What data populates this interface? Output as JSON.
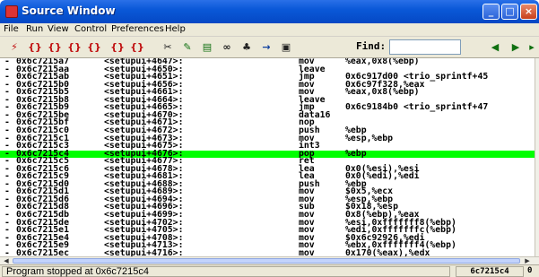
{
  "window": {
    "title": "Source Window",
    "min_icon": "minimize-icon",
    "max_icon": "maximize-icon",
    "close_icon": "close-icon"
  },
  "menu": {
    "items": [
      "File",
      "Run",
      "View",
      "Control",
      "Preferences",
      "Help"
    ]
  },
  "toolbar": {
    "find_label": "Find:",
    "find_value": "",
    "icons": [
      "run-icon",
      "step-icon",
      "next-icon",
      "finish-icon",
      "continue-icon",
      "stepi-icon",
      "nexti-icon",
      "up-stack-icon",
      "down-stack-icon",
      "bottom-stack-icon",
      "watch-icon",
      "locals-icon",
      "breakpoints-icon",
      "registers-icon",
      "memory-icon",
      "find-prev-icon",
      "find-next-icon"
    ]
  },
  "code": {
    "highlight_color": "#00ff00",
    "rows": [
      {
        "marker": "-",
        "addr": "0x6c7215a7",
        "sym": "<setupui+4647>:",
        "mn": "mov",
        "op": "%eax,0x8(%ebp)"
      },
      {
        "marker": "-",
        "addr": "0x6c7215aa",
        "sym": "<setupui+4650>:",
        "mn": "leave",
        "op": ""
      },
      {
        "marker": "-",
        "addr": "0x6c7215ab",
        "sym": "<setupui+4651>:",
        "mn": "jmp",
        "op": "0x6c917d00 <trio_sprintf+45"
      },
      {
        "marker": "-",
        "addr": "0x6c7215b0",
        "sym": "<setupui+4656>:",
        "mn": "mov",
        "op": "0x6c97f328,%eax"
      },
      {
        "marker": "-",
        "addr": "0x6c7215b5",
        "sym": "<setupui+4661>:",
        "mn": "mov",
        "op": "%eax,0x8(%ebp)"
      },
      {
        "marker": "-",
        "addr": "0x6c7215b8",
        "sym": "<setupui+4664>:",
        "mn": "leave",
        "op": ""
      },
      {
        "marker": "-",
        "addr": "0x6c7215b9",
        "sym": "<setupui+4665>:",
        "mn": "jmp",
        "op": "0x6c9184b0 <trio_sprintf+47"
      },
      {
        "marker": "-",
        "addr": "0x6c7215be",
        "sym": "<setupui+4670>:",
        "mn": "data16",
        "op": ""
      },
      {
        "marker": "-",
        "addr": "0x6c7215bf",
        "sym": "<setupui+4671>:",
        "mn": "nop",
        "op": ""
      },
      {
        "marker": "-",
        "addr": "0x6c7215c0",
        "sym": "<setupui+4672>:",
        "mn": "push",
        "op": "%ebp"
      },
      {
        "marker": "-",
        "addr": "0x6c7215c1",
        "sym": "<setupui+4673>:",
        "mn": "mov",
        "op": "%esp,%ebp"
      },
      {
        "marker": "-",
        "addr": "0x6c7215c3",
        "sym": "<setupui+4675>:",
        "mn": "int3",
        "op": ""
      },
      {
        "marker": "-",
        "addr": "0x6c7215c4",
        "sym": "<setupui+4676>:",
        "mn": "pop",
        "op": "%ebp",
        "highlight": true
      },
      {
        "marker": "-",
        "addr": "0x6c7215c5",
        "sym": "<setupui+4677>:",
        "mn": "ret",
        "op": ""
      },
      {
        "marker": "-",
        "addr": "0x6c7215c6",
        "sym": "<setupui+4678>:",
        "mn": "lea",
        "op": "0x0(%esi),%esi"
      },
      {
        "marker": "-",
        "addr": "0x6c7215c9",
        "sym": "<setupui+4681>:",
        "mn": "lea",
        "op": "0x0(%edi),%edi"
      },
      {
        "marker": "-",
        "addr": "0x6c7215d0",
        "sym": "<setupui+4688>:",
        "mn": "push",
        "op": "%ebp"
      },
      {
        "marker": "-",
        "addr": "0x6c7215d1",
        "sym": "<setupui+4689>:",
        "mn": "mov",
        "op": "$0x5,%ecx"
      },
      {
        "marker": "-",
        "addr": "0x6c7215d6",
        "sym": "<setupui+4694>:",
        "mn": "mov",
        "op": "%esp,%ebp"
      },
      {
        "marker": "-",
        "addr": "0x6c7215d8",
        "sym": "<setupui+4696>:",
        "mn": "sub",
        "op": "$0x18,%esp"
      },
      {
        "marker": "-",
        "addr": "0x6c7215db",
        "sym": "<setupui+4699>:",
        "mn": "mov",
        "op": "0x8(%ebp),%eax"
      },
      {
        "marker": "-",
        "addr": "0x6c7215de",
        "sym": "<setupui+4702>:",
        "mn": "mov",
        "op": "%esi,0xfffffff8(%ebp)"
      },
      {
        "marker": "-",
        "addr": "0x6c7215e1",
        "sym": "<setupui+4705>:",
        "mn": "mov",
        "op": "%edi,0xfffffffc(%ebp)"
      },
      {
        "marker": "-",
        "addr": "0x6c7215e4",
        "sym": "<setupui+4708>:",
        "mn": "mov",
        "op": "$0x6c92926,%edi"
      },
      {
        "marker": "-",
        "addr": "0x6c7215e9",
        "sym": "<setupui+4713>:",
        "mn": "mov",
        "op": "%ebx,0xfffffff4(%ebp)"
      },
      {
        "marker": "-",
        "addr": "0x6c7215ec",
        "sym": "<setupui+4716>:",
        "mn": "mov",
        "op": "0x170(%eax),%edx"
      }
    ]
  },
  "status": {
    "message": "Program stopped at 0x6c7215c4",
    "address": "6c7215c4",
    "extra": "0"
  }
}
